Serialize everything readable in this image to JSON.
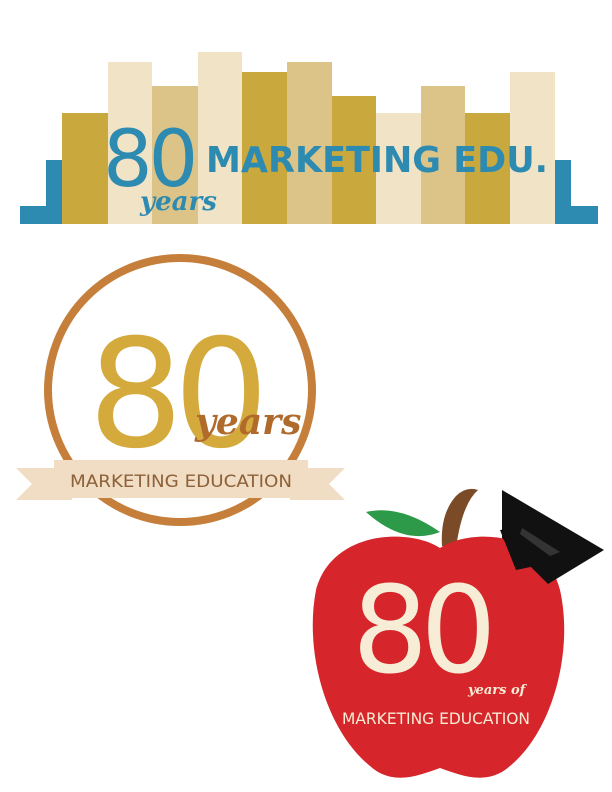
{
  "logo_books": {
    "number": "80",
    "years": "years",
    "tagline": "MARKETING EDU."
  },
  "logo_circle": {
    "number": "80",
    "years": "years",
    "banner": "MARKETING EDUCATION"
  },
  "logo_apple": {
    "number": "80",
    "years_of": "years of",
    "tagline": "MARKETING EDUCATION"
  },
  "colors": {
    "teal": "#2d8ab0",
    "gold": "#c9a93e",
    "tan": "#dcc489",
    "cream": "#f1e3c5",
    "copper": "#c57f3b",
    "circle_gold": "#d4aa3c",
    "script_brown": "#b06a2c",
    "banner_fill": "#f1dcc4",
    "banner_text": "#8c6138",
    "apple_red": "#d7262b",
    "leaf_green": "#2c9a48",
    "stem_brown": "#7b4a26",
    "cap_black": "#111111",
    "apple_text": "#f7ecd6"
  }
}
